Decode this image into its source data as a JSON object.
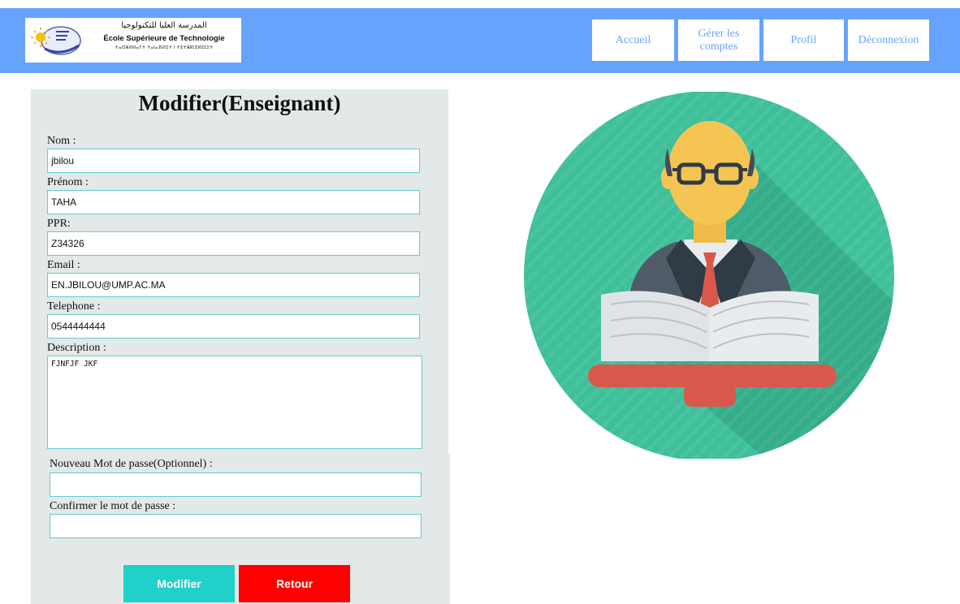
{
  "header": {
    "logo": {
      "arabic": "المدرسة العليا للتكنولوجيا",
      "school": "École Supérieure de Technologie",
      "tifinagh": "ⵜⴰⵙⴻⵍⵍⴰⵢⵜ ⵜⴰⵏⴰⴼⵍⵉⵜ ⵏ ⵜⵓⵜⴻⴽⵏⵓⵍⵓⵊⵉⵜ"
    },
    "nav": [
      {
        "label": "Accueil"
      },
      {
        "label": "Gérer les comptes"
      },
      {
        "label": "Profil"
      },
      {
        "label": "Déconnexion"
      }
    ]
  },
  "form": {
    "title": "Modifier(Enseignant)",
    "nom": {
      "label": "Nom :",
      "value": "jbilou"
    },
    "prenom": {
      "label": "Prénom :",
      "value": "TAHA"
    },
    "ppr": {
      "label": "PPR:",
      "value": "Z34326"
    },
    "email": {
      "label": "Email :",
      "value": "EN.JBILOU@UMP.AC.MA"
    },
    "telephone": {
      "label": "Telephone :",
      "value": "0544444444"
    },
    "description": {
      "label": "Description :",
      "value": "FJNFJF JKF"
    },
    "new_password": {
      "label": "Nouveau Mot de passe(Optionnel) :",
      "value": ""
    },
    "confirm_password": {
      "label": "Confirmer le mot de passe :",
      "value": ""
    },
    "submit_label": "Modifier",
    "back_label": "Retour"
  },
  "colors": {
    "header_bg": "#66a3ff",
    "panel_bg": "#e3e8e8",
    "input_border": "#66cccc",
    "submit_bg": "#1fd1c8",
    "back_bg": "#ff0000",
    "illustration_circle": "#3fbf9a"
  },
  "icons": {
    "illustration": "teacher-with-book-icon",
    "logo": "school-logo"
  }
}
